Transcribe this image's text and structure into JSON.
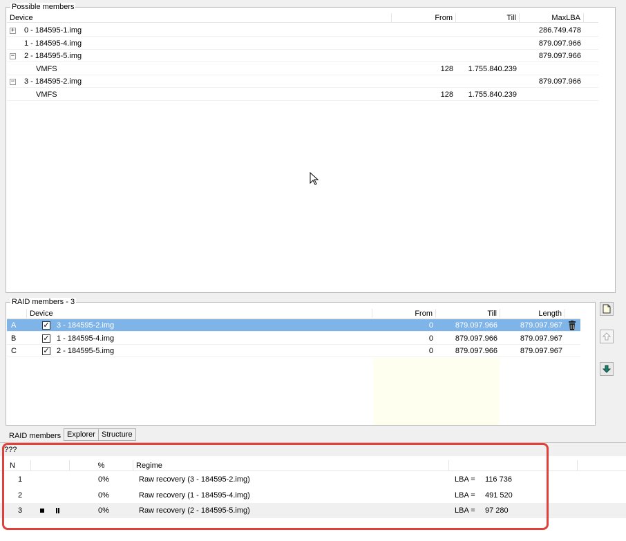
{
  "possible_members": {
    "title": "Possible members",
    "columns": [
      "Device",
      "From",
      "Till",
      "MaxLBA"
    ],
    "rows": [
      {
        "toggle": "+",
        "device": "0 - 184595-1.img",
        "from": "",
        "till": "",
        "maxlba": "286.749.478",
        "indent": 0
      },
      {
        "toggle": "",
        "device": "1 - 184595-4.img",
        "from": "",
        "till": "",
        "maxlba": "879.097.966",
        "indent": 0
      },
      {
        "toggle": "−",
        "device": "2 - 184595-5.img",
        "from": "",
        "till": "",
        "maxlba": "879.097.966",
        "indent": 0
      },
      {
        "toggle": "",
        "device": "VMFS",
        "from": "128",
        "till": "1.755.840.239",
        "maxlba": "",
        "indent": 1
      },
      {
        "toggle": "−",
        "device": "3 - 184595-2.img",
        "from": "",
        "till": "",
        "maxlba": "879.097.966",
        "indent": 0
      },
      {
        "toggle": "",
        "device": "VMFS",
        "from": "128",
        "till": "1.755.840.239",
        "maxlba": "",
        "indent": 1
      }
    ]
  },
  "raid_members": {
    "title": "RAID members - 3",
    "columns": [
      "Device",
      "From",
      "Till",
      "Length"
    ],
    "rows": [
      {
        "letter": "A",
        "checked": "✓",
        "device": "3 - 184595-2.img",
        "from": "0",
        "till": "879.097.966",
        "length": "879.097.967"
      },
      {
        "letter": "B",
        "checked": "✓",
        "device": "1 - 184595-4.img",
        "from": "0",
        "till": "879.097.966",
        "length": "879.097.967"
      },
      {
        "letter": "C",
        "checked": "✓",
        "device": "2 - 184595-5.img",
        "from": "0",
        "till": "879.097.966",
        "length": "879.097.967"
      }
    ]
  },
  "tabs": [
    "RAID members",
    "Explorer",
    "Structure"
  ],
  "tasks": {
    "label": "???",
    "columns": [
      "N",
      "",
      "%",
      "Regime"
    ],
    "rows": [
      {
        "n": "1",
        "controls": false,
        "percent": "0%",
        "regime": "Raw recovery (3 - 184595-2.img)",
        "lba_label": "LBA =",
        "lba": "116 736"
      },
      {
        "n": "2",
        "controls": false,
        "percent": "0%",
        "regime": "Raw recovery (1 - 184595-4.img)",
        "lba_label": "LBA =",
        "lba": "491 520"
      },
      {
        "n": "3",
        "controls": true,
        "percent": "0%",
        "regime": "Raw recovery (2 - 184595-5.img)",
        "lba_label": "LBA =",
        "lba": "97 280"
      }
    ]
  },
  "colors": {
    "selection": "#7eb4e8",
    "highlight_frame": "#e0403a",
    "till_column_tint": "#fffff0"
  }
}
